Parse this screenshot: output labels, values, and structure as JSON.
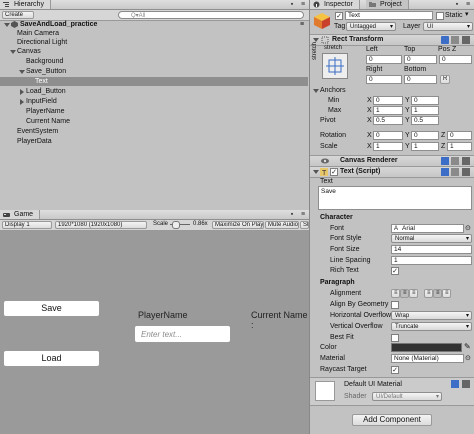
{
  "hierarchy": {
    "tab_label": "Hierarchy",
    "create_label": "Create",
    "search_placeholder": "Q▾All",
    "scene_name": "SaveAndLoad_practice",
    "items": [
      {
        "label": "Main Camera"
      },
      {
        "label": "Directional Light"
      },
      {
        "label": "Canvas"
      },
      {
        "label": "Background"
      },
      {
        "label": "Save_Button"
      },
      {
        "label": "Text"
      },
      {
        "label": "Load_Button"
      },
      {
        "label": "InputField"
      },
      {
        "label": "PlayerName"
      },
      {
        "label": "Current Name"
      },
      {
        "label": "EventSystem"
      },
      {
        "label": "PlayerData"
      }
    ]
  },
  "game": {
    "tab_label": "Game",
    "display": "Display 1",
    "resolution": "1920*1080 (1920x1080)",
    "scale_label": "Scale",
    "scale_value": "0.86x",
    "maximize": "Maximize On Play",
    "mute": "Mute Audio",
    "stats": "Stat",
    "save_button": "Save",
    "load_button": "Load",
    "player_name_label": "PlayerName",
    "input_placeholder": "Enter text...",
    "current_name_label": "Current Name :"
  },
  "inspector": {
    "tab_inspector": "Inspector",
    "tab_project": "Project",
    "object_name": "Text",
    "static_label": "Static",
    "tag_label": "Tag",
    "tag_value": "Untagged",
    "layer_label": "Layer",
    "layer_value": "UI",
    "rect_transform": {
      "title": "Rect Transform",
      "stretch_label": "stretch",
      "stretch_side": "stretch",
      "left_label": "Left",
      "top_label": "Top",
      "posz_label": "Pos Z",
      "left": "0",
      "top": "0",
      "posz": "0",
      "right_label": "Right",
      "bottom_label": "Bottom",
      "right": "0",
      "bottom": "0",
      "r_label": "R",
      "anchors_label": "Anchors",
      "min_label": "Min",
      "max_label": "Max",
      "min_x": "0",
      "min_y": "0",
      "max_x": "1",
      "max_y": "1",
      "pivot_label": "Pivot",
      "pivot_x": "0.5",
      "pivot_y": "0.5",
      "rotation_label": "Rotation",
      "rot_x": "0",
      "rot_y": "0",
      "rot_z": "0",
      "scale_label": "Scale",
      "scale_x": "1",
      "scale_y": "1",
      "scale_z": "1",
      "x": "X",
      "y": "Y",
      "z": "Z"
    },
    "canvas_renderer": {
      "title": "Canvas Renderer"
    },
    "text_script": {
      "title": "Text (Script)",
      "text_label": "Text",
      "text_value": "Save",
      "character_label": "Character",
      "font_label": "Font",
      "font_value": "Arial",
      "font_style_label": "Font Style",
      "font_style_value": "Normal",
      "font_size_label": "Font Size",
      "font_size_value": "14",
      "line_spacing_label": "Line Spacing",
      "line_spacing_value": "1",
      "rich_text_label": "Rich Text",
      "paragraph_label": "Paragraph",
      "alignment_label": "Alignment",
      "align_geometry_label": "Align By Geometry",
      "h_overflow_label": "Horizontal Overflow",
      "h_overflow_value": "Wrap",
      "v_overflow_label": "Vertical Overflow",
      "v_overflow_value": "Truncate",
      "best_fit_label": "Best Fit",
      "color_label": "Color",
      "material_label": "Material",
      "material_value": "None (Material)",
      "raycast_label": "Raycast Target"
    },
    "material_section": {
      "title": "Default UI Material",
      "shader_label": "Shader",
      "shader_value": "UI/Default"
    },
    "add_component": "Add Component"
  }
}
